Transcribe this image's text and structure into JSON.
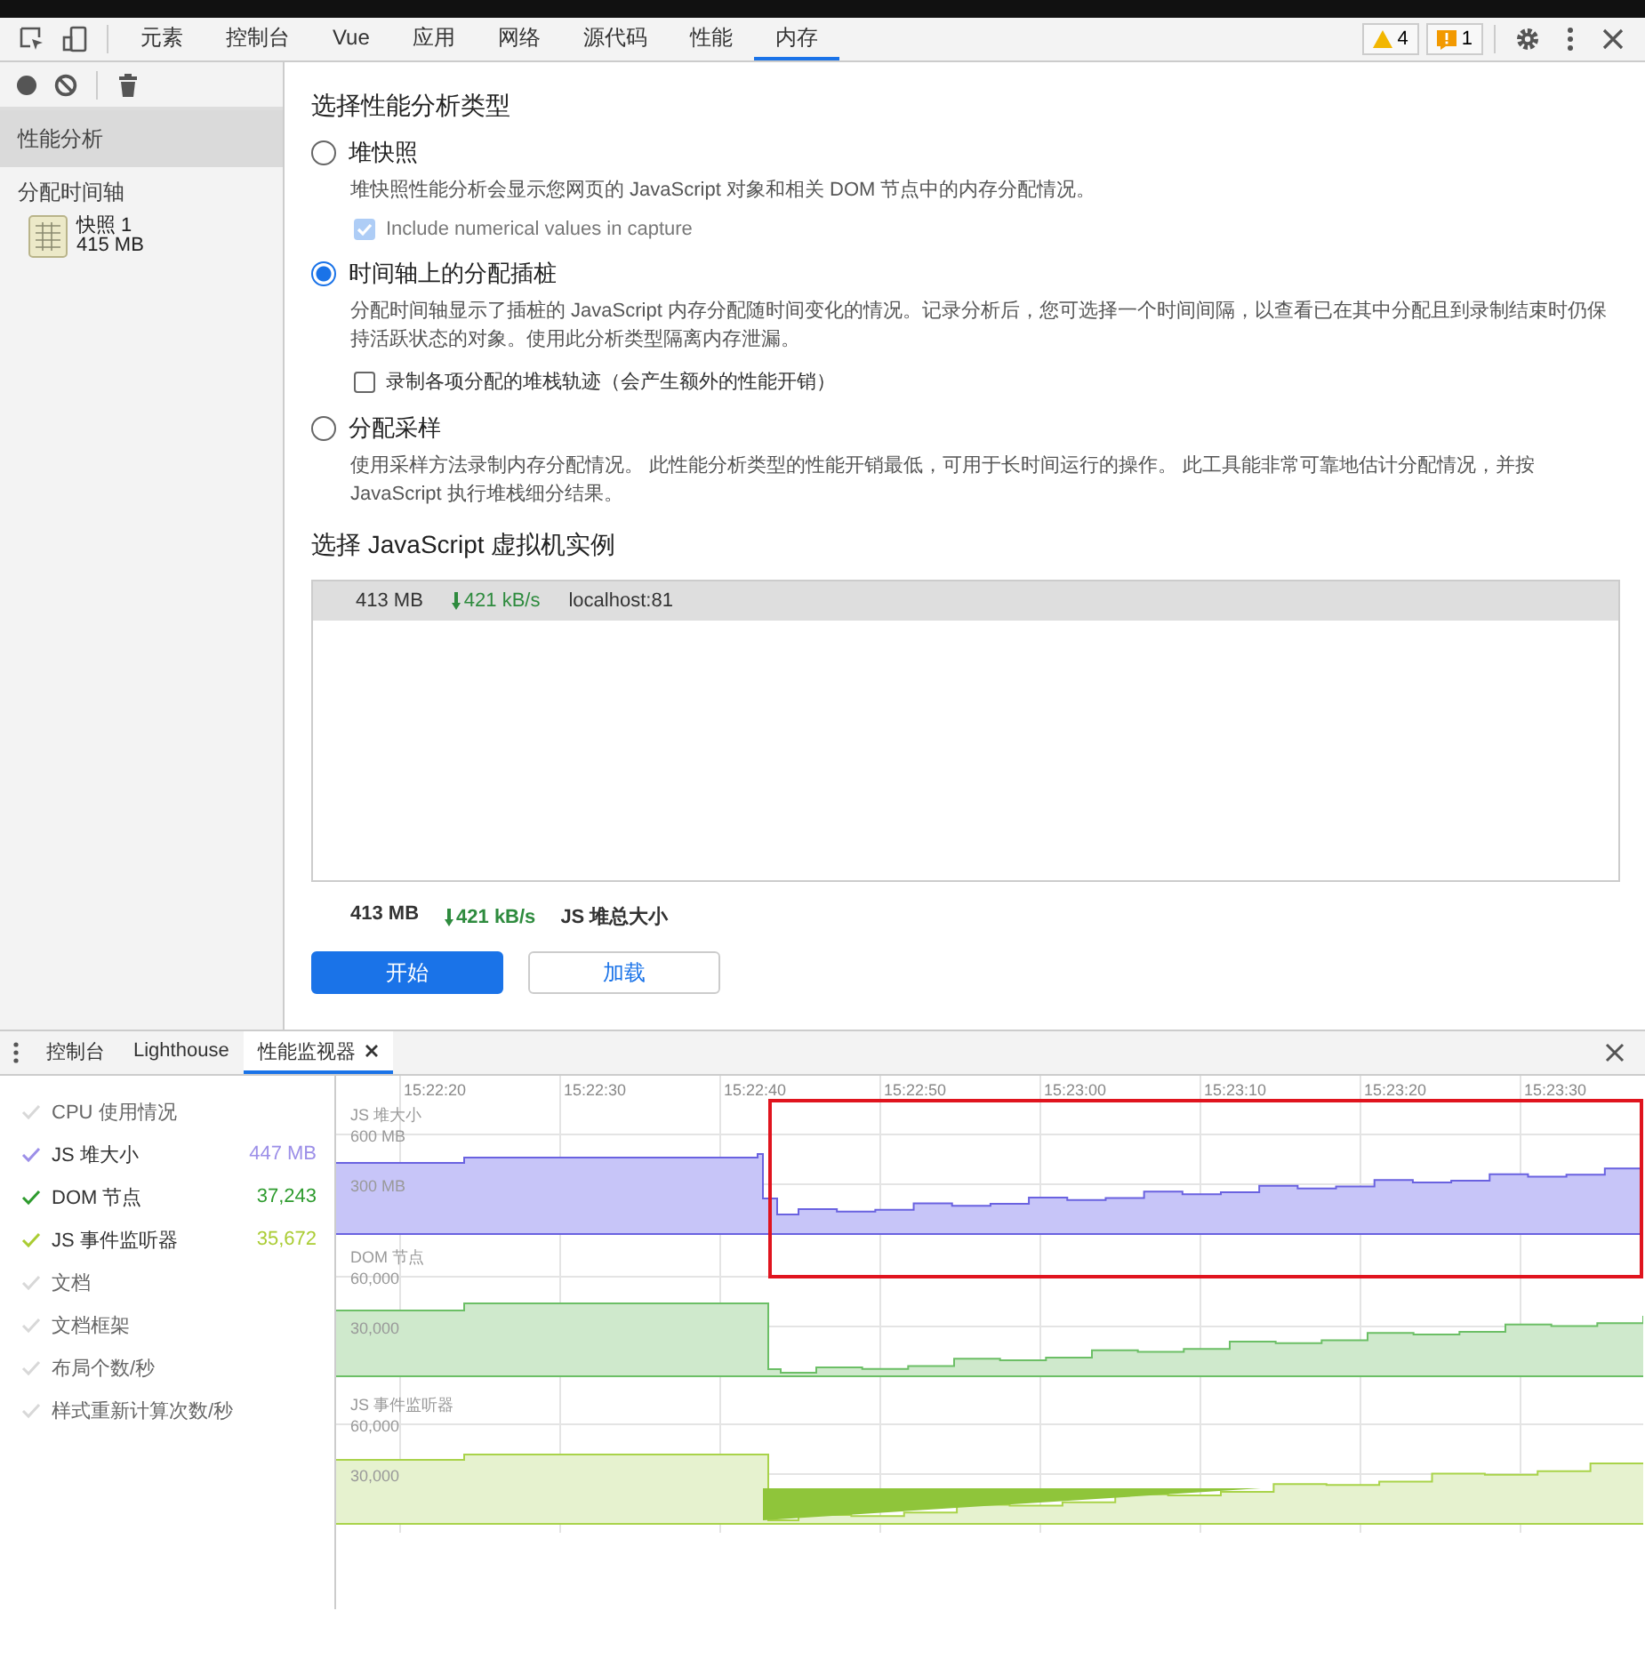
{
  "toolbar": {
    "tabs": [
      {
        "label": "元素",
        "selected": false
      },
      {
        "label": "控制台",
        "selected": false
      },
      {
        "label": "Vue",
        "selected": false
      },
      {
        "label": "应用",
        "selected": false
      },
      {
        "label": "网络",
        "selected": false
      },
      {
        "label": "源代码",
        "selected": false
      },
      {
        "label": "性能",
        "selected": false
      },
      {
        "label": "内存",
        "selected": true
      }
    ],
    "warnings": "4",
    "issues": "1"
  },
  "sidebar": {
    "heading": "性能分析",
    "heading_selected": true,
    "group": "分配时间轴",
    "snapshots": [
      {
        "title": "快照 1",
        "size": "415 MB"
      }
    ]
  },
  "profile": {
    "title": "选择性能分析类型",
    "options": [
      {
        "title": "堆快照",
        "selected": false,
        "description": "堆快照性能分析会显示您网页的 JavaScript 对象和相关 DOM 节点中的内存分配情况。",
        "checkbox": {
          "label": "Include numerical values in capture",
          "checked": true,
          "disabled": true
        }
      },
      {
        "title": "时间轴上的分配插桩",
        "selected": true,
        "description": "分配时间轴显示了插桩的 JavaScript 内存分配随时间变化的情况。记录分析后，您可选择一个时间间隔，以查看已在其中分配且到录制结束时仍保持活跃状态的对象。使用此分析类型隔离内存泄漏。",
        "checkbox": {
          "label": "录制各项分配的堆栈轨迹（会产生额外的性能开销）",
          "checked": false,
          "disabled": false
        }
      },
      {
        "title": "分配采样",
        "selected": false,
        "description": "使用采样方法录制内存分配情况。 此性能分析类型的性能开销最低，可用于长时间运行的操作。 此工具能非常可靠地估计分配情况，并按 JavaScript 执行堆栈细分结果。"
      }
    ],
    "vm_title": "选择 JavaScript 虚拟机实例",
    "vm_rows": [
      {
        "size": "413 MB",
        "rate": "421 kB/s",
        "url": "localhost:81",
        "selected": true
      }
    ],
    "totals": {
      "size": "413 MB",
      "rate": "421 kB/s",
      "label": "JS 堆总大小"
    },
    "buttons": [
      {
        "label": "开始",
        "kind": "primary"
      },
      {
        "label": "加载",
        "kind": "secondary"
      }
    ]
  },
  "drawer": {
    "tabs": [
      {
        "label": "控制台",
        "selected": false,
        "closable": false
      },
      {
        "label": "Lighthouse",
        "selected": false,
        "closable": false
      },
      {
        "label": "性能监视器",
        "selected": true,
        "closable": true
      }
    ],
    "metrics": [
      {
        "label": "CPU 使用情况",
        "checked": false
      },
      {
        "label": "JS 堆大小",
        "checked": true,
        "color": "#9c8fe8",
        "value": "447 MB"
      },
      {
        "label": "DOM 节点",
        "checked": true,
        "color": "#2e9b2e",
        "value": "37,243"
      },
      {
        "label": "JS 事件监听器",
        "checked": true,
        "color": "#aacc33",
        "value": "35,672"
      },
      {
        "label": "文档",
        "checked": false
      },
      {
        "label": "文档框架",
        "checked": false
      },
      {
        "label": "布局个数/秒",
        "checked": false
      },
      {
        "label": "样式重新计算次数/秒",
        "checked": false
      }
    ],
    "times": [
      "15:22:20",
      "15:22:30",
      "15:22:40",
      "15:22:50",
      "15:23:00",
      "15:23:10",
      "15:23:20",
      "15:23:30"
    ],
    "graphs": [
      {
        "title": "JS 堆大小",
        "ticks": [
          "600 MB",
          "300 MB"
        ]
      },
      {
        "title": "DOM 节点",
        "ticks": [
          "60,000",
          "30,000"
        ]
      },
      {
        "title": "JS 事件监听器",
        "ticks": [
          "60,000",
          "30,000"
        ]
      }
    ]
  }
}
